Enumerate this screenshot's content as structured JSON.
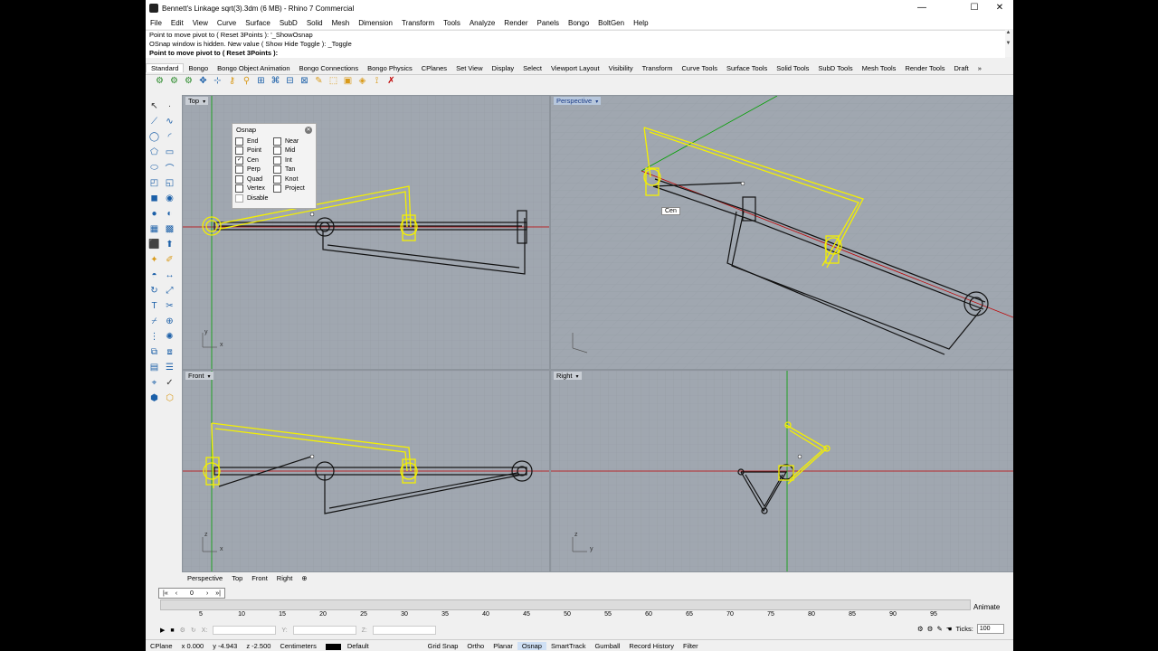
{
  "title_bar": {
    "title": "Bennett's Linkage sqrt(3).3dm (6 MB) - Rhino 7 Commercial",
    "minimize": "—",
    "maximize": "☐",
    "close": "✕"
  },
  "menu": [
    "File",
    "Edit",
    "View",
    "Curve",
    "Surface",
    "SubD",
    "Solid",
    "Mesh",
    "Dimension",
    "Transform",
    "Tools",
    "Analyze",
    "Render",
    "Panels",
    "Bongo",
    "BoltGen",
    "Help"
  ],
  "command_history": {
    "line1": "Point to move pivot to ( Reset  3Points ): '_ShowOsnap",
    "line2": "OSnap window is hidden. New value ( Show  Hide  Toggle ): _Toggle",
    "prompt": "Point to move pivot to ( Reset  3Points ):"
  },
  "toolbar_tabs": [
    "Standard",
    "Bongo",
    "Bongo Object Animation",
    "Bongo Connections",
    "Bongo Physics",
    "CPlanes",
    "Set View",
    "Display",
    "Select",
    "Viewport Layout",
    "Visibility",
    "Transform",
    "Curve Tools",
    "Surface Tools",
    "Solid Tools",
    "SubD Tools",
    "Mesh Tools",
    "Render Tools",
    "Draft"
  ],
  "toolbar_tabs_more": "»",
  "viewports": {
    "top": {
      "label": "Top",
      "axis_x": "x",
      "axis_y": "y"
    },
    "perspective": {
      "label": "Perspective",
      "snap_tooltip": "Cen"
    },
    "front": {
      "label": "Front",
      "axis_x": "x",
      "axis_z": "z"
    },
    "right": {
      "label": "Right",
      "axis_y": "y",
      "axis_z": "z"
    }
  },
  "osnap": {
    "title": "Osnap",
    "items": [
      {
        "label": "End",
        "checked": false
      },
      {
        "label": "Near",
        "checked": false
      },
      {
        "label": "Point",
        "checked": false
      },
      {
        "label": "Mid",
        "checked": false
      },
      {
        "label": "Cen",
        "checked": true
      },
      {
        "label": "Int",
        "checked": false
      },
      {
        "label": "Perp",
        "checked": false
      },
      {
        "label": "Tan",
        "checked": false
      },
      {
        "label": "Quad",
        "checked": false
      },
      {
        "label": "Knot",
        "checked": false
      },
      {
        "label": "Vertex",
        "checked": false
      },
      {
        "label": "Project",
        "checked": false
      }
    ],
    "disable": "Disable"
  },
  "view_tabs": [
    "Perspective",
    "Top",
    "Front",
    "Right"
  ],
  "view_tabs_add": "⊕",
  "timeline": {
    "frame": "0",
    "ticks": [
      "5",
      "10",
      "15",
      "20",
      "25",
      "30",
      "35",
      "40",
      "45",
      "50",
      "55",
      "60",
      "65",
      "70",
      "75",
      "80",
      "85",
      "90",
      "95"
    ],
    "animate_label": "Animate",
    "ticks_label": "Ticks:",
    "ticks_value": "100",
    "x_label": "X:",
    "y_label": "Y:",
    "z_label": "Z:"
  },
  "status": {
    "cplane": "CPlane",
    "x": "x 0.000",
    "y": "y -4.943",
    "z": "z -2.500",
    "units": "Centimeters",
    "layer": "Default",
    "toggles": [
      "Grid Snap",
      "Ortho",
      "Planar",
      "Osnap",
      "SmartTrack",
      "Gumball",
      "Record History",
      "Filter"
    ],
    "active_toggle": "Osnap"
  },
  "colors": {
    "selection": "#f4f000",
    "viewport_bg": "#a0a7b0",
    "x_axis": "#c00000",
    "y_axis": "#00a000"
  }
}
